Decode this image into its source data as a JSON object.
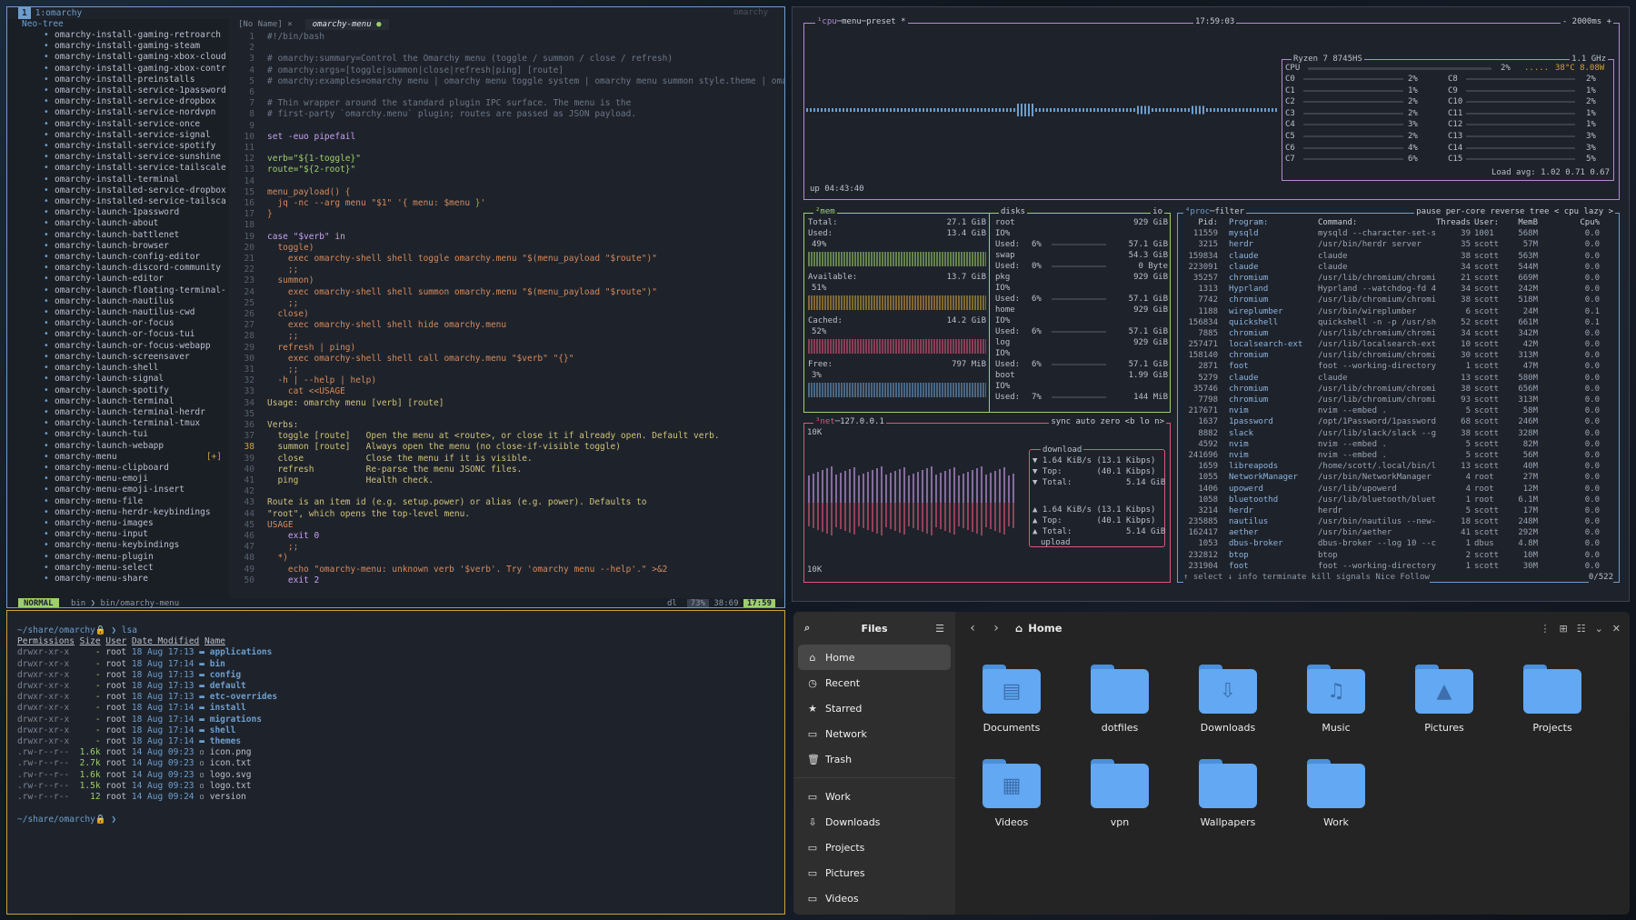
{
  "nvim": {
    "tree_tag": "1",
    "tree_title": "1:omarchy",
    "tree_sub": "Neo-tree",
    "workspace_label": "omarchy",
    "tree_items": [
      "omarchy-install-gaming-retroarch",
      "omarchy-install-gaming-steam",
      "omarchy-install-gaming-xbox-cloud",
      "omarchy-install-gaming-xbox-contr",
      "omarchy-install-preinstalls",
      "omarchy-install-service-1password",
      "omarchy-install-service-dropbox",
      "omarchy-install-service-nordvpn",
      "omarchy-install-service-once",
      "omarchy-install-service-signal",
      "omarchy-install-service-spotify",
      "omarchy-install-service-sunshine",
      "omarchy-install-service-tailscale",
      "omarchy-install-terminal",
      "omarchy-installed-service-dropbox",
      "omarchy-installed-service-tailsca",
      "omarchy-launch-1password",
      "omarchy-launch-about",
      "omarchy-launch-battlenet",
      "omarchy-launch-browser",
      "omarchy-launch-config-editor",
      "omarchy-launch-discord-community",
      "omarchy-launch-editor",
      "omarchy-launch-floating-terminal-",
      "omarchy-launch-nautilus",
      "omarchy-launch-nautilus-cwd",
      "omarchy-launch-or-focus",
      "omarchy-launch-or-focus-tui",
      "omarchy-launch-or-focus-webapp",
      "omarchy-launch-screensaver",
      "omarchy-launch-shell",
      "omarchy-launch-signal",
      "omarchy-launch-spotify",
      "omarchy-launch-terminal",
      "omarchy-launch-terminal-herdr",
      "omarchy-launch-terminal-tmux",
      "omarchy-launch-tui",
      "omarchy-launch-webapp",
      "omarchy-menu",
      "omarchy-menu-clipboard",
      "omarchy-menu-emoji",
      "omarchy-menu-emoji-insert",
      "omarchy-menu-file",
      "omarchy-menu-herdr-keybindings",
      "omarchy-menu-images",
      "omarchy-menu-input",
      "omarchy-menu-keybindings",
      "omarchy-menu-plugin",
      "omarchy-menu-select",
      "omarchy-menu-share"
    ],
    "modified_marker": "[+]",
    "tabs": [
      "[No Name]",
      "omarchy-menu"
    ],
    "tab_close": "×",
    "tab_dot": "●",
    "code": [
      "#!/bin/bash",
      "",
      "# omarchy:summary=Control the Omarchy menu (toggle / summon / close / refresh)",
      "# omarchy:args=[toggle|summon|close|refresh|ping] [route]",
      "# omarchy:examples=omarchy menu | omarchy menu toggle system | omarchy menu summon style.theme | oma",
      "",
      "# Thin wrapper around the standard plugin IPC surface. The menu is the",
      "# first-party `omarchy.menu` plugin; routes are passed as JSON payload.",
      "",
      "set -euo pipefail",
      "",
      "verb=\"${1-toggle}\"",
      "route=\"${2-root}\"",
      "",
      "menu_payload() {",
      "  jq -nc --arg menu \"$1\" '{ menu: $menu }'",
      "}",
      "",
      "case \"$verb\" in",
      "  toggle)",
      "    exec omarchy-shell shell toggle omarchy.menu \"$(menu_payload \"$route\")\"",
      "    ;;",
      "  summon)",
      "    exec omarchy-shell shell summon omarchy.menu \"$(menu_payload \"$route\")\"",
      "    ;;",
      "  close)",
      "    exec omarchy-shell shell hide omarchy.menu",
      "    ;;",
      "  refresh | ping)",
      "    exec omarchy-shell shell call omarchy.menu \"$verb\" \"{}\"",
      "    ;;",
      "  -h | --help | help)",
      "    cat <<USAGE",
      "Usage: omarchy menu [verb] [route]",
      "",
      "Verbs:",
      "  toggle [route]   Open the menu at <route>, or close it if already open. Default verb.",
      "  summon [route]   Always open the menu (no close-if-visible toggle)",
      "  close            Close the menu if it is visible.",
      "  refresh          Re-parse the menu JSONC files.",
      "  ping             Health check.",
      "",
      "Route is an item id (e.g. setup.power) or alias (e.g. power). Defaults to",
      "\"root\", which opens the top-level menu.",
      "USAGE",
      "    exit 0",
      "    ;;",
      "  *)",
      "    echo \"omarchy-menu: unknown verb '$verb'. Try 'omarchy menu --help'.\" >&2",
      "    exit 2"
    ],
    "status": {
      "mode": "NORMAL",
      "path": "bin  ❯  bin/omarchy-menu",
      "lsp": "dl",
      "pct": "73%",
      "pos": "38:69",
      "time": "17:59"
    }
  },
  "terminal": {
    "prompt1": "~/share/omarchy🔒 ❯ lsa",
    "header": [
      "Permissions",
      "Size",
      "User",
      "Date Modified",
      "Name"
    ],
    "rows": [
      {
        "perm": "drwxr-xr-x",
        "size": "-",
        "user": "root",
        "date": "18 Aug 17:13",
        "name": "applications",
        "dir": true
      },
      {
        "perm": "drwxr-xr-x",
        "size": "-",
        "user": "root",
        "date": "18 Aug 17:14",
        "name": "bin",
        "dir": true
      },
      {
        "perm": "drwxr-xr-x",
        "size": "-",
        "user": "root",
        "date": "18 Aug 17:13",
        "name": "config",
        "dir": true
      },
      {
        "perm": "drwxr-xr-x",
        "size": "-",
        "user": "root",
        "date": "18 Aug 17:13",
        "name": "default",
        "dir": true
      },
      {
        "perm": "drwxr-xr-x",
        "size": "-",
        "user": "root",
        "date": "18 Aug 17:13",
        "name": "etc-overrides",
        "dir": true
      },
      {
        "perm": "drwxr-xr-x",
        "size": "-",
        "user": "root",
        "date": "18 Aug 17:14",
        "name": "install",
        "dir": true
      },
      {
        "perm": "drwxr-xr-x",
        "size": "-",
        "user": "root",
        "date": "18 Aug 17:14",
        "name": "migrations",
        "dir": true
      },
      {
        "perm": "drwxr-xr-x",
        "size": "-",
        "user": "root",
        "date": "18 Aug 17:14",
        "name": "shell",
        "dir": true
      },
      {
        "perm": "drwxr-xr-x",
        "size": "-",
        "user": "root",
        "date": "18 Aug 17:14",
        "name": "themes",
        "dir": true
      },
      {
        "perm": ".rw-r--r--",
        "size": "1.6k",
        "user": "root",
        "date": "14 Aug 09:23",
        "name": "icon.png",
        "dir": false
      },
      {
        "perm": ".rw-r--r--",
        "size": "2.7k",
        "user": "root",
        "date": "14 Aug 09:23",
        "name": "icon.txt",
        "dir": false
      },
      {
        "perm": ".rw-r--r--",
        "size": "1.6k",
        "user": "root",
        "date": "14 Aug 09:23",
        "name": "logo.svg",
        "dir": false
      },
      {
        "perm": ".rw-r--r--",
        "size": "1.5k",
        "user": "root",
        "date": "14 Aug 09:23",
        "name": "logo.txt",
        "dir": false
      },
      {
        "perm": ".rw-r--r--",
        "size": "12",
        "user": "root",
        "date": "14 Aug 09:24",
        "name": "version",
        "dir": false
      }
    ],
    "prompt2": "~/share/omarchy🔒 ❯"
  },
  "btop": {
    "cpu_title": "¹cpu",
    "cpu_menu": "menu",
    "cpu_preset": "preset *",
    "clock": "17:59:03",
    "interval": "- 2000ms +",
    "cpu_model": "Ryzen 7 8745HS",
    "cpu_freq": "1.1 GHz",
    "cpu_total": "CPU",
    "cpu_total_pct": "2%",
    "cpu_temp": "38°C 8.08W",
    "cores_left": [
      [
        "C0",
        "2%"
      ],
      [
        "C1",
        "1%"
      ],
      [
        "C2",
        "2%"
      ],
      [
        "C3",
        "2%"
      ],
      [
        "C4",
        "3%"
      ],
      [
        "C5",
        "2%"
      ],
      [
        "C6",
        "4%"
      ],
      [
        "C7",
        "6%"
      ]
    ],
    "cores_right": [
      [
        "C8",
        "2%"
      ],
      [
        "C9",
        "1%"
      ],
      [
        "C10",
        "2%"
      ],
      [
        "C11",
        "1%"
      ],
      [
        "C12",
        "1%"
      ],
      [
        "C13",
        "3%"
      ],
      [
        "C14",
        "3%"
      ],
      [
        "C15",
        "5%"
      ]
    ],
    "load_avg": "Load avg: 1.02 0.71 0.67",
    "uptime": "up 04:43:40",
    "mem": {
      "title": "²mem",
      "total_l": "Total:",
      "total": "27.1 GiB",
      "used_l": "Used:",
      "used": "13.4 GiB",
      "used_pct": "49%",
      "avail_l": "Available:",
      "avail": "13.7 GiB",
      "avail_pct": "51%",
      "cached_l": "Cached:",
      "cached": "14.2 GiB",
      "cached_pct": "52%",
      "free_l": "Free:",
      "free": "797 MiB",
      "free_pct": "3%"
    },
    "disks": {
      "title": "disks",
      "io": "io",
      "items": [
        {
          "name": "root",
          "total": "929 GiB",
          "io": "IO%",
          "used_pct": "6%",
          "used": "57.1 GiB"
        },
        {
          "name": "swap",
          "total": "54.3 GiB",
          "io": "",
          "used_pct": "0%",
          "used": "0 Byte"
        },
        {
          "name": "pkg",
          "total": "929 GiB",
          "io": "IO%",
          "used_pct": "6%",
          "used": "57.1 GiB"
        },
        {
          "name": "home",
          "total": "929 GiB",
          "io": "IO%",
          "used_pct": "6%",
          "used": "57.1 GiB"
        },
        {
          "name": "log",
          "total": "929 GiB",
          "io": "IO%",
          "used_pct": "6%",
          "used": "57.1 GiB"
        },
        {
          "name": "boot",
          "total": "1.99 GiB",
          "io": "IO%",
          "used_pct": "7%",
          "used": "144 MiB"
        }
      ]
    },
    "net": {
      "title": "³net",
      "iface": "127.0.0.1",
      "opts": "sync auto zero <b lo n>",
      "scale_top": "10K",
      "scale_bot": "10K",
      "download": "download",
      "dl_rate": "1.64 KiB/s (13.1 Kibps)",
      "dl_top": "(40.1 Kibps)",
      "dl_total": "5.14 GiB",
      "upload": "upload",
      "ul_rate": "1.64 KiB/s (13.1 Kibps)",
      "ul_top": "(40.1 Kibps)",
      "ul_total": "5.14 GiB"
    },
    "proc": {
      "title": "⁴proc",
      "filter": "filter",
      "opts": "pause per-core reverse tree < cpu lazy >",
      "headers": [
        "Pid:",
        "Program:",
        "Command:",
        "Threads:",
        "User:",
        "MemB",
        "Cpu%"
      ],
      "rows": [
        [
          "11559",
          "mysqld",
          "mysqld --character-set-s",
          "39",
          "1001",
          "568M",
          "0.0"
        ],
        [
          "3215",
          "herdr",
          "/usr/bin/herdr server",
          "35",
          "scott",
          "57M",
          "0.0"
        ],
        [
          "159834",
          "claude",
          "claude",
          "38",
          "scott",
          "563M",
          "0.0"
        ],
        [
          "223091",
          "claude",
          "claude",
          "34",
          "scott",
          "544M",
          "0.0"
        ],
        [
          "35257",
          "chromium",
          "/usr/lib/chromium/chromi",
          "21",
          "scott",
          "669M",
          "0.0"
        ],
        [
          "1313",
          "Hyprland",
          "Hyprland --watchdog-fd 4",
          "34",
          "scott",
          "242M",
          "0.0"
        ],
        [
          "7742",
          "chromium",
          "/usr/lib/chromium/chromi",
          "38",
          "scott",
          "518M",
          "0.0"
        ],
        [
          "1188",
          "wireplumber",
          "/usr/bin/wireplumber",
          "6",
          "scott",
          "24M",
          "0.1"
        ],
        [
          "156834",
          "quickshell",
          "quickshell -n -p /usr/sh",
          "52",
          "scott",
          "661M",
          "0.1"
        ],
        [
          "7885",
          "chromium",
          "/usr/lib/chromium/chromi",
          "34",
          "scott",
          "342M",
          "0.0"
        ],
        [
          "257471",
          "localsearch-ext",
          "/usr/lib/localsearch-ext",
          "10",
          "scott",
          "42M",
          "0.0"
        ],
        [
          "158140",
          "chromium",
          "/usr/lib/chromium/chromi",
          "30",
          "scott",
          "313M",
          "0.0"
        ],
        [
          "2871",
          "foot",
          "foot --working-directory",
          "1",
          "scott",
          "47M",
          "0.0"
        ],
        [
          "5279",
          "claude",
          "claude",
          "13",
          "scott",
          "580M",
          "0.0"
        ],
        [
          "35746",
          "chromium",
          "/usr/lib/chromium/chromi",
          "38",
          "scott",
          "656M",
          "0.0"
        ],
        [
          "7798",
          "chromium",
          "/usr/lib/chromium/chromi",
          "93",
          "scott",
          "313M",
          "0.0"
        ],
        [
          "217671",
          "nvim",
          "nvim --embed .",
          "5",
          "scott",
          "58M",
          "0.0"
        ],
        [
          "1637",
          "1password",
          "/opt/1Password/1password",
          "68",
          "scott",
          "246M",
          "0.0"
        ],
        [
          "8882",
          "slack",
          "/usr/lib/slack/slack --g",
          "38",
          "scott",
          "328M",
          "0.0"
        ],
        [
          "4592",
          "nvim",
          "nvim --embed .",
          "5",
          "scott",
          "82M",
          "0.0"
        ],
        [
          "241696",
          "nvim",
          "nvim --embed .",
          "5",
          "scott",
          "56M",
          "0.0"
        ],
        [
          "1659",
          "libreapods",
          "/home/scott/.local/bin/l",
          "13",
          "scott",
          "40M",
          "0.0"
        ],
        [
          "1055",
          "NetworkManager",
          "/usr/bin/NetworkManager",
          "4",
          "root",
          "27M",
          "0.0"
        ],
        [
          "1406",
          "upowerd",
          "/usr/lib/upowerd",
          "4",
          "root",
          "12M",
          "0.0"
        ],
        [
          "1058",
          "bluetoothd",
          "/usr/lib/bluetooth/bluet",
          "1",
          "root",
          "6.1M",
          "0.0"
        ],
        [
          "3214",
          "herdr",
          "herdr",
          "5",
          "scott",
          "17M",
          "0.0"
        ],
        [
          "235885",
          "nautilus",
          "/usr/bin/nautilus --new-",
          "18",
          "scott",
          "248M",
          "0.0"
        ],
        [
          "162417",
          "aether",
          "/usr/bin/aether",
          "41",
          "scott",
          "292M",
          "0.0"
        ],
        [
          "1053",
          "dbus-broker",
          "dbus-broker --log 10 --c",
          "1",
          "dbus",
          "4.8M",
          "0.0"
        ],
        [
          "232812",
          "btop",
          "btop",
          "2",
          "scott",
          "10M",
          "0.0"
        ],
        [
          "231904",
          "foot",
          "foot --working-directory",
          "1",
          "scott",
          "30M",
          "0.0"
        ]
      ],
      "footer": "↑ select ↓ info terminate kill signals Nice Follow",
      "count": "0/522"
    }
  },
  "files": {
    "sidebar_title": "Files",
    "sidebar": [
      {
        "label": "Home",
        "icon": "⌂"
      },
      {
        "label": "Recent",
        "icon": "◷"
      },
      {
        "label": "Starred",
        "icon": "★"
      },
      {
        "label": "Network",
        "icon": "▭"
      },
      {
        "label": "Trash",
        "icon": "🗑"
      }
    ],
    "bookmarks": [
      {
        "label": "Work",
        "icon": "▭"
      },
      {
        "label": "Downloads",
        "icon": "⇩"
      },
      {
        "label": "Projects",
        "icon": "▭"
      },
      {
        "label": "Pictures",
        "icon": "▭"
      },
      {
        "label": "Videos",
        "icon": "▭"
      }
    ],
    "path": "Home",
    "folders": [
      {
        "name": "Documents",
        "sym": "▤"
      },
      {
        "name": "dotfiles",
        "sym": ""
      },
      {
        "name": "Downloads",
        "sym": "⇩"
      },
      {
        "name": "Music",
        "sym": "♫"
      },
      {
        "name": "Pictures",
        "sym": "▲"
      },
      {
        "name": "Projects",
        "sym": ""
      },
      {
        "name": "Videos",
        "sym": "▦"
      },
      {
        "name": "vpn",
        "sym": ""
      },
      {
        "name": "Wallpapers",
        "sym": ""
      },
      {
        "name": "Work",
        "sym": ""
      }
    ]
  }
}
